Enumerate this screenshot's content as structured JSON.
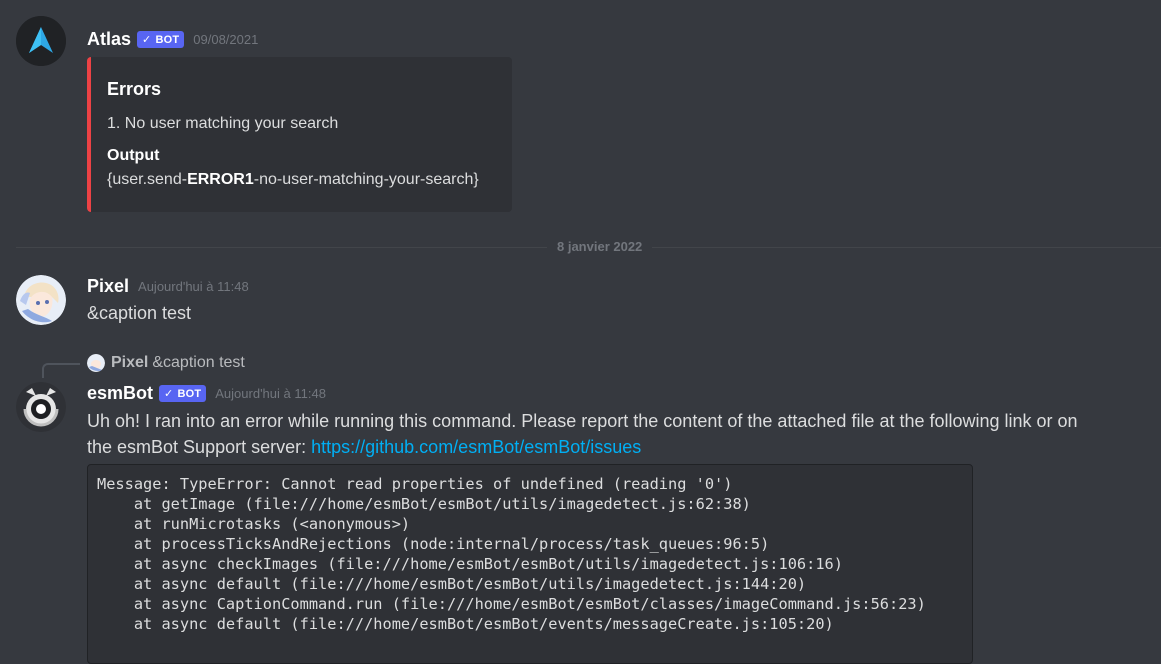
{
  "messages": {
    "atlas": {
      "username": "Atlas",
      "bot_tag": "BOT",
      "bot_check": "✓",
      "timestamp": "09/08/2021",
      "embed": {
        "title": "Errors",
        "description": "1. No user matching your search",
        "field_name": "Output",
        "field_value_prefix": "{user.send-",
        "field_value_bold": "ERROR1",
        "field_value_suffix": "-no-user-matching-your-search}",
        "accent_color": "#ed4245"
      }
    },
    "divider": {
      "label": "8 janvier 2022"
    },
    "pixel": {
      "username": "Pixel",
      "timestamp": "Aujourd'hui à 11:48",
      "content": "&caption test"
    },
    "esmbot": {
      "reply": {
        "username": "Pixel",
        "content": "&caption test"
      },
      "username": "esmBot",
      "bot_tag": "BOT",
      "bot_check": "✓",
      "timestamp": "Aujourd'hui à 11:48",
      "content_line1": "Uh oh! I ran into an error while running this command. Please report the content of the attached file at the following link or on",
      "content_line2_prefix": "the esmBot Support server: ",
      "link": "https://github.com/esmBot/esmBot/issues",
      "code_lines": [
        "Message: TypeError: Cannot read properties of undefined (reading '0')",
        "    at getImage (file:///home/esmBot/esmBot/utils/imagedetect.js:62:38)",
        "    at runMicrotasks (<anonymous>)",
        "    at processTicksAndRejections (node:internal/process/task_queues:96:5)",
        "    at async checkImages (file:///home/esmBot/esmBot/utils/imagedetect.js:106:16)",
        "    at async default (file:///home/esmBot/esmBot/utils/imagedetect.js:144:20)",
        "    at async CaptionCommand.run (file:///home/esmBot/esmBot/classes/imageCommand.js:56:23)",
        "    at async default (file:///home/esmBot/esmBot/events/messageCreate.js:105:20)"
      ]
    }
  },
  "colors": {
    "background": "#36393f",
    "bot_tag": "#5865f2",
    "link": "#00aff4",
    "embed_bg": "#2f3136"
  },
  "icons": {
    "atlas_avatar": "atlas-logo-icon",
    "pixel_avatar": "anime-avatar-icon",
    "esmbot_avatar": "esmbot-logo-icon"
  }
}
